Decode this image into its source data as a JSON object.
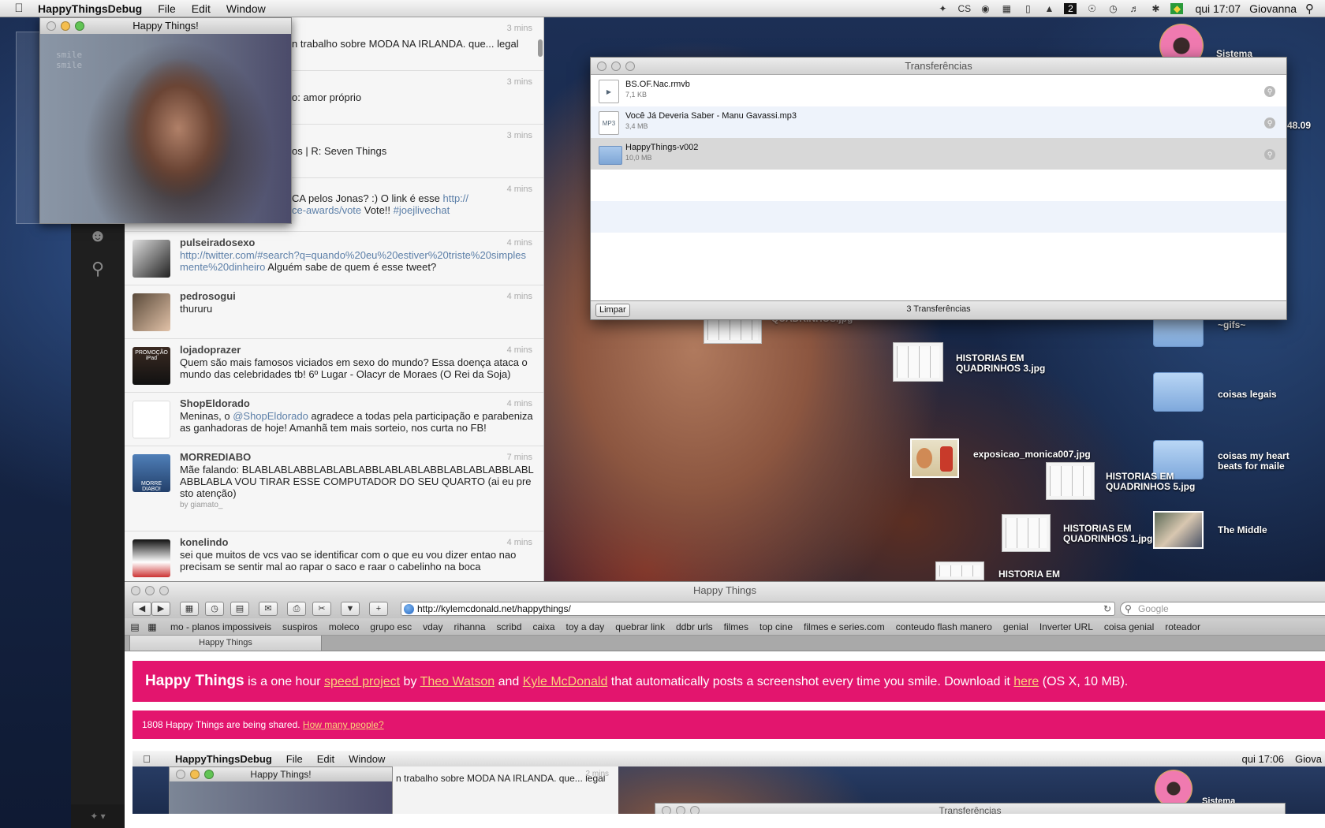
{
  "menubar": {
    "app_name": "HappyThingsDebug",
    "menus": [
      "File",
      "Edit",
      "Window"
    ],
    "clock": "qui 17:07",
    "user": "Giovanna",
    "status_icons": [
      "twitter-icon",
      "cs-icon",
      "chrome-icon",
      "dropbox-icon",
      "battery-icon",
      "wifi-icon",
      "two-icon",
      "accessibility-icon",
      "time-machine-icon",
      "volume-icon",
      "bluetooth-icon",
      "brazil-flag-icon"
    ],
    "cs_label": "CS",
    "two_label": "2"
  },
  "webcam": {
    "title": "Happy Things!",
    "overlay_line1": "smile",
    "overlay_line2": "smile"
  },
  "tweets": [
    {
      "user": "",
      "text": "n trabalho sobre MODA NA IRLANDA. que... legal",
      "time": "3 mins"
    },
    {
      "user": "",
      "text": "o: amor próprio",
      "time": "3 mins"
    },
    {
      "user": "",
      "text": "os | R: Seven Things",
      "time": "3 mins"
    },
    {
      "user": "",
      "text_a": "CA pelos Jonas? :) O link é esse ",
      "link_a": "http://",
      "link_b": "ce-awards/vote",
      "text_b": " Vote!! ",
      "hashtag": "#joejlivechat",
      "time": "4 mins"
    },
    {
      "user": "pulseiradosexo",
      "link": "http://twitter.com/#search?q=quando%20eu%20estiver%20triste%20simplesmente%20dinheiro",
      "text": " Alguém sabe de quem é esse tweet?",
      "time": "4 mins"
    },
    {
      "user": "pedrosogui",
      "text": "thururu",
      "time": "4 mins"
    },
    {
      "user": "lojadoprazer",
      "text": "Quem são mais famosos viciados em sexo do mundo?  Essa doença ataca o mundo das celebridades tb! 6º Lugar - Olacyr de Moraes (O Rei da Soja)",
      "time": "4 mins",
      "avatar_text": "PROMOÇÃO iPad"
    },
    {
      "user": "ShopEldorado",
      "text_a": "Meninas, o ",
      "mention": "@ShopEldorado",
      "text_b": " agradece a todas pela participação e parabeniza as ganhadoras de hoje! Amanhã tem mais sorteio, nos curta no FB!",
      "time": "4 mins"
    },
    {
      "user": "MORREDIABO",
      "text": "Mãe falando: BLABLABLABBLABLABLABBLABLABLABBLABLABLABBLABLABBLABLA VOU TIRAR ESSE COMPUTADOR DO SEU QUARTO (ai eu presto atenção)",
      "via": "by giamato_",
      "time": "7 mins",
      "avatar_text": "MORRE DIABO!"
    },
    {
      "user": "konelindo",
      "text": "sei que muitos de vcs vao se identificar com o que eu vou dizer entao nao precisam se sentir mal ao rapar o saco e raar o cabelinho na boca",
      "time": "4 mins"
    }
  ],
  "downloads": {
    "title": "Transferências",
    "items": [
      {
        "name": "BS.OF.Nac.rmvb",
        "size": "7,1 KB",
        "icon": "video-file-icon"
      },
      {
        "name": "Você Já Deveria Saber - Manu Gavassi.mp3",
        "size": "3,4 MB",
        "icon": "mp3-file-icon",
        "badge": "MP3"
      },
      {
        "name": "HappyThings-v002",
        "size": "10,0 MB",
        "icon": "folder-icon"
      }
    ],
    "clear_label": "Limpar",
    "count_label": "3 Transferências"
  },
  "desktop_icons": [
    {
      "label": "Sistema"
    },
    {
      "label": "~gifs~"
    },
    {
      "label": "coisas legais"
    },
    {
      "label": "coisas my heart beats for maile"
    },
    {
      "label": "The Middle"
    },
    {
      "label": "HISTORIAS EM QUADRINHOS 3.jpg"
    },
    {
      "label": "exposicao_monica007.jpg"
    },
    {
      "label": "HISTORIAS EM QUADRINHOS 5.jpg"
    },
    {
      "label": "HISTORIAS EM QUADRINHOS 1.jpg"
    },
    {
      "label": "HISTORIA EM"
    },
    {
      "label": "QUADRINHOS.jpg"
    }
  ],
  "partial_number": "48.09",
  "safari": {
    "title": "Happy Things",
    "url": "http://kylemcdonald.net/happythings/",
    "search_placeholder": "Google",
    "bookmarks": [
      "mo - planos impossiveis",
      "suspiros",
      "moleco",
      "grupo esc",
      "vday",
      "rihanna",
      "scribd",
      "caixa",
      "toy a day",
      "quebrar link",
      "ddbr urls",
      "filmes",
      "top cine",
      "filmes e series.com",
      "conteudo flash manero",
      "genial",
      "Inverter URL",
      "coisa genial",
      "roteador"
    ],
    "tab_label": "Happy Things",
    "banner": {
      "bold": "Happy Things",
      "t1": " is a one hour ",
      "link1": "speed project",
      "t2": " by ",
      "link2": "Theo Watson",
      "t3": " and ",
      "link3": "Kyle McDonald",
      "t4": " that automatically posts a screenshot every time you smile. Download it ",
      "link4": "here",
      "t5": " (OS X, 10 MB)."
    },
    "counter_text": "1808 Happy Things are being shared. ",
    "counter_link": "How many people?"
  },
  "mini_screenshot": {
    "app_name": "HappyThingsDebug",
    "menus": [
      "File",
      "Edit",
      "Window"
    ],
    "clock": "qui 17:06",
    "user": "Giova",
    "cam_title": "Happy Things!",
    "tweet_text": "n trabalho sobre MODA NA IRLANDA. que... legal",
    "tweet_time": "2 mins",
    "dl_title": "Transferências",
    "desktop_label": "Sistema"
  }
}
